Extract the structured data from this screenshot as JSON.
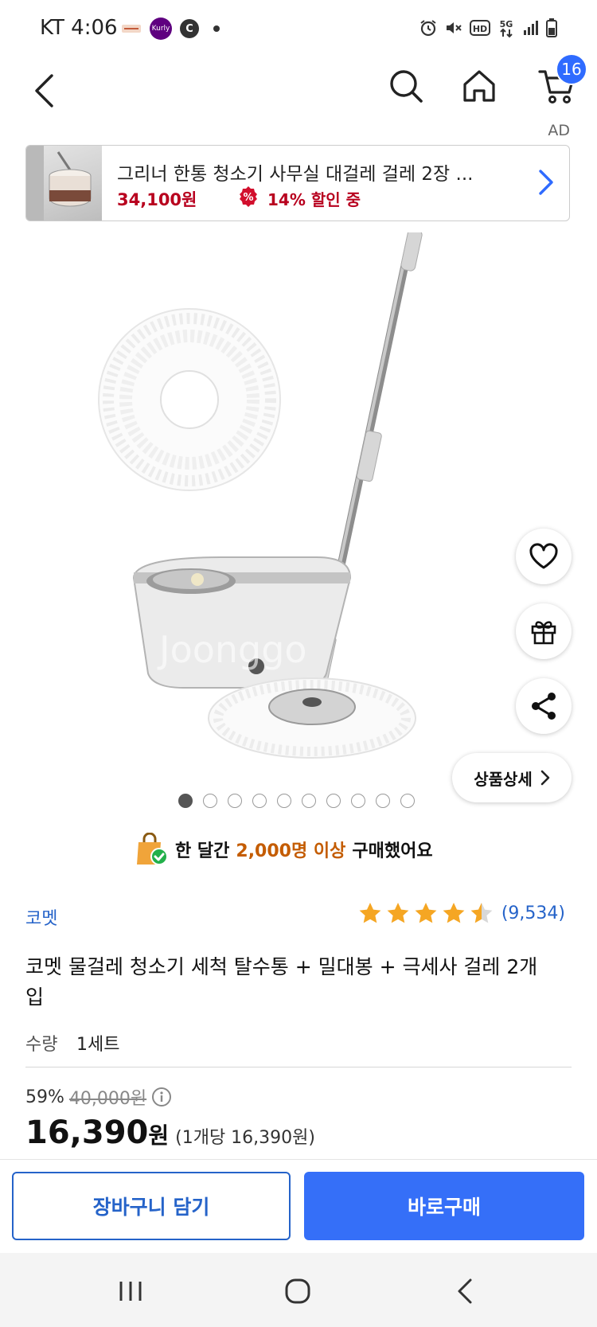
{
  "status_bar": {
    "time": "KT 4:06",
    "left_icons": [
      "fashion-app-icon",
      "kurly-icon",
      "c-icon",
      "dot-icon"
    ],
    "kurly_label": "Kurly",
    "c_label": "C",
    "right_icons": [
      "alarm-icon",
      "mute-icon",
      "hd-icon",
      "5g-icon",
      "signal-icon",
      "battery-icon"
    ]
  },
  "nav": {
    "cart_count": "16"
  },
  "ad": {
    "tag": "AD",
    "title": "그리너 한통 청소기 사무실 대걸레 걸레 2장 ...",
    "price": "34,100원",
    "discount": "14% 할인 중",
    "discount_icon_symbol": "%"
  },
  "image": {
    "page_count": 10,
    "active_page": 1,
    "watermark": "Joonggo"
  },
  "actions": {
    "detail_label": "상품상세"
  },
  "proof": {
    "prefix": "한 달간 ",
    "highlight": "2,000명 이상",
    "suffix": " 구매했어요"
  },
  "product": {
    "brand": "코멧",
    "rating": 4.5,
    "review_count": "(9,534)",
    "title": "코멧 물걸레 청소기 세척 탈수통 + 밀대봉 + 극세사 걸레 2개입",
    "qty_label": "수량",
    "qty_value": "1세트",
    "discount_rate": "59%",
    "original_price": "40,000원",
    "price": "16,390",
    "price_unit": "원",
    "per_unit": "(1개당 16,390원)"
  },
  "cta": {
    "cart_label": "장바구니 담기",
    "buy_label": "바로구매"
  },
  "colors": {
    "accent_blue": "#2563c9",
    "buy_blue": "#356ff8",
    "ad_red": "#b8001e",
    "proof_orange": "#c45c00",
    "star": "#f5a623"
  }
}
